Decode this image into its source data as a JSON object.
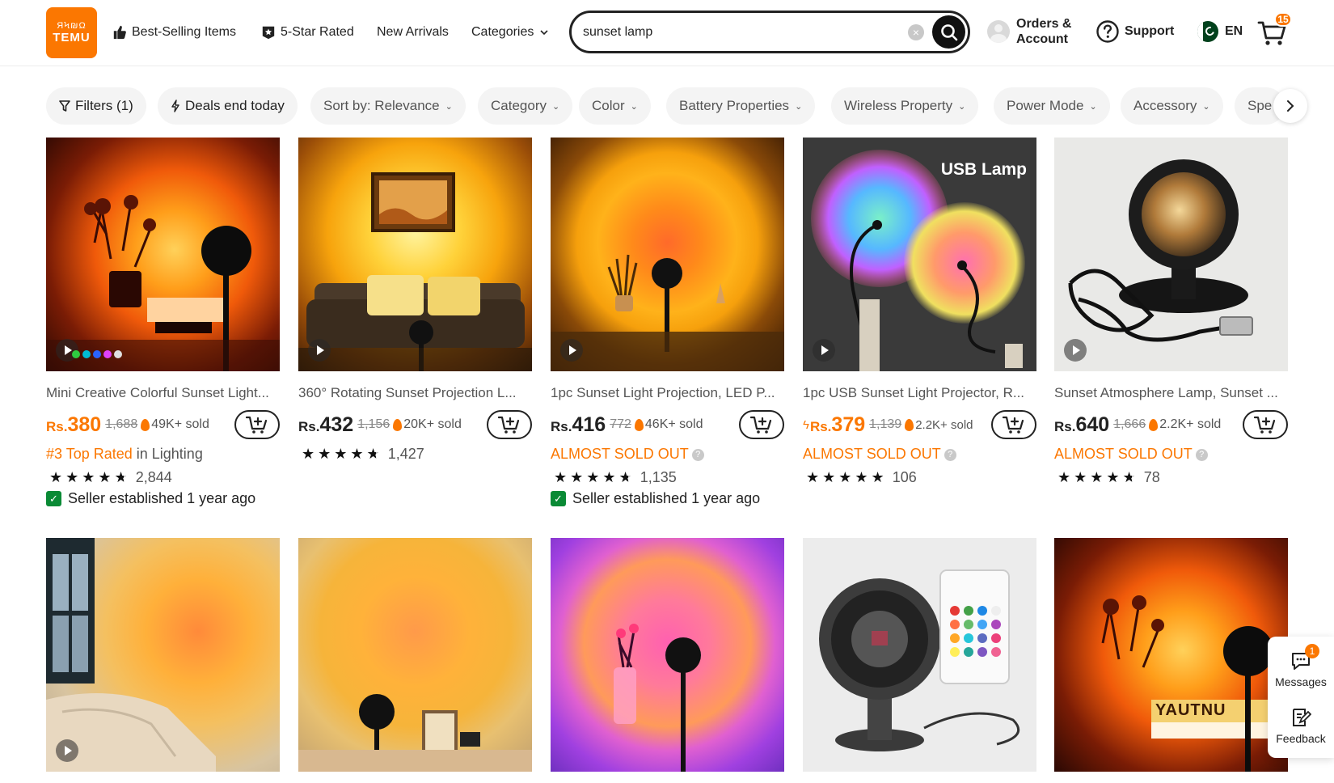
{
  "header": {
    "logo_icon": "ЯϞ₪Ω",
    "logo_text": "TEMU",
    "nav": {
      "best_selling": "Best-Selling Items",
      "five_star": "5-Star Rated",
      "new_arrivals": "New Arrivals",
      "categories": "Categories"
    },
    "search_value": "sunset lamp",
    "orders_line1": "Orders &",
    "orders_line2": "Account",
    "support": "Support",
    "language": "EN",
    "cart_count": "15",
    "icons": [
      "thumbs-up-icon",
      "star-badge-icon",
      "chevron-down-icon",
      "clear-icon",
      "search-icon",
      "avatar-icon",
      "question-icon",
      "pakistan-flag-icon",
      "cart-icon"
    ]
  },
  "filters": {
    "filters": "Filters (1)",
    "deals": "Deals end today",
    "sort": "Sort by: Relevance",
    "category": "Category",
    "color": "Color",
    "battery": "Battery Properties",
    "wireless": "Wireless Property",
    "power": "Power Mode",
    "accessory": "Accessory",
    "spe": "Spe"
  },
  "products": [
    {
      "title": "Mini Creative Colorful Sunset Light...",
      "currency": "Rs.",
      "price": "380",
      "old_price": "1,688",
      "sold": "49K+ sold",
      "badge_rank": "#3 Top Rated",
      "badge_rest": " in Lighting",
      "rating": 4.5,
      "reviews": "2,844",
      "seller": "Seller established 1 year ago"
    },
    {
      "title": "360° Rotating Sunset Projection L...",
      "currency": "Rs.",
      "price": "432",
      "old_price": "1,156",
      "sold": "20K+ sold",
      "rating": 4.5,
      "reviews": "1,427"
    },
    {
      "title": "1pc Sunset Light Projection, LED P...",
      "currency": "Rs.",
      "price": "416",
      "old_price": "772",
      "sold": "46K+ sold",
      "status": "ALMOST SOLD OUT",
      "rating": 4.5,
      "reviews": "1,135",
      "seller": "Seller established 1 year ago"
    },
    {
      "title": "1pc USB Sunset Light Projector, R...",
      "currency": "Rs.",
      "price": "379",
      "old_price": "1,139",
      "sold": "2.2K+ sold",
      "status": "ALMOST SOLD OUT",
      "rating": 5,
      "reviews": "106",
      "image_label": "USB Lamp"
    },
    {
      "title": "Sunset Atmosphere Lamp, Sunset ...",
      "currency": "Rs.",
      "price": "640",
      "old_price": "1,666",
      "sold": "2.2K+ sold",
      "status": "ALMOST SOLD OUT",
      "rating": 4.5,
      "reviews": "78"
    }
  ],
  "row2_labels": {
    "box_text": "YAUTNU"
  },
  "float_panel": {
    "messages": "Messages",
    "messages_badge": "1",
    "feedback": "Feedback"
  },
  "colors": {
    "accent": "#fb7701",
    "text": "#222222",
    "muted": "#555555",
    "seller_green": "#0a8a35"
  }
}
